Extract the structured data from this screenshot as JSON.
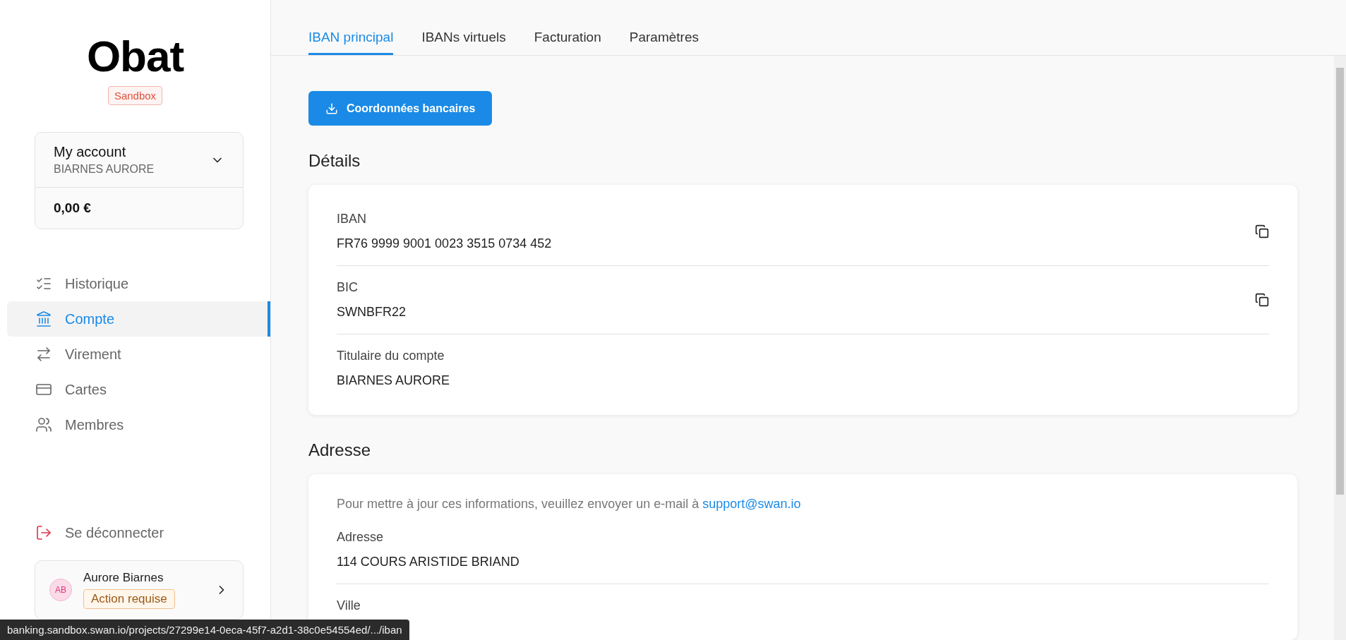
{
  "sidebar": {
    "logo": "Obat",
    "environment_badge": "Sandbox",
    "account": {
      "title": "My account",
      "holder": "BIARNES AURORE",
      "balance": "0,00 €"
    },
    "items": [
      {
        "label": "Historique",
        "kind": "list",
        "selected": false
      },
      {
        "label": "Compte",
        "kind": "bank",
        "selected": true
      },
      {
        "label": "Virement",
        "kind": "transfer",
        "selected": false
      },
      {
        "label": "Cartes",
        "kind": "card",
        "selected": false
      },
      {
        "label": "Membres",
        "kind": "members",
        "selected": false
      }
    ],
    "logout": "Se déconnecter",
    "user": {
      "initials": "AB",
      "name": "Aurore Biarnes",
      "status": "Action requise"
    }
  },
  "tabs": [
    {
      "label": "IBAN principal",
      "selected": true
    },
    {
      "label": "IBANs virtuels",
      "selected": false
    },
    {
      "label": "Facturation",
      "selected": false
    },
    {
      "label": "Paramètres",
      "selected": false
    }
  ],
  "download_button": "Coordonnées bancaires",
  "details": {
    "heading": "Détails",
    "fields": [
      {
        "label": "IBAN",
        "value": "FR76 9999 9001 0023 3515 0734 452",
        "copyable": true
      },
      {
        "label": "BIC",
        "value": "SWNBFR22",
        "copyable": true
      },
      {
        "label": "Titulaire du compte",
        "value": "BIARNES AURORE",
        "copyable": false
      }
    ]
  },
  "address": {
    "heading": "Adresse",
    "notice": "Pour mettre à jour ces informations, veuillez envoyer un e-mail à",
    "email": "support@swan.io",
    "fields": [
      {
        "label": "Adresse",
        "value": "114 COURS ARISTIDE BRIAND"
      },
      {
        "label": "Ville"
      }
    ]
  },
  "status_bar": "banking.sandbox.swan.io/projects/27299e14-0eca-45f7-a2d1-38c0e54554ed/.../iban"
}
